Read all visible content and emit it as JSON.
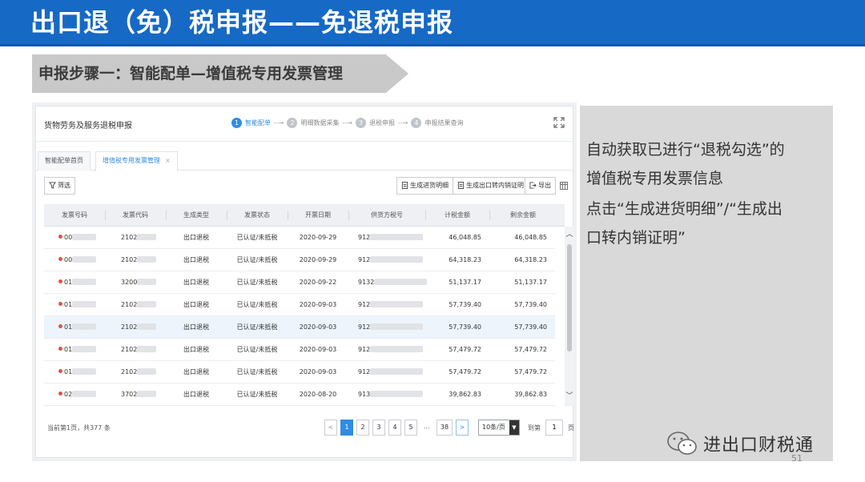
{
  "slide": {
    "title": "出口退（免）税申报——免退税申报",
    "step_banner": "申报步骤一：智能配单—增值税专用发票管理",
    "page_number": "51"
  },
  "app": {
    "window_title": "货物劳务及服务退税申报",
    "steps": [
      {
        "num": "1",
        "label": "智能配单",
        "active": true
      },
      {
        "num": "2",
        "label": "明细数据采集",
        "active": false
      },
      {
        "num": "3",
        "label": "退税申报",
        "active": false
      },
      {
        "num": "4",
        "label": "申报结果查询",
        "active": false
      }
    ],
    "tabs": [
      {
        "label": "智能配单首页",
        "active": false
      },
      {
        "label": "增值税专用发票管理",
        "active": true,
        "close": "×"
      }
    ],
    "toolbar": {
      "filter": "筛选",
      "gen_purchase": "生成进货明细",
      "gen_cert": "生成出口转内销证明",
      "export": "导出"
    },
    "table": {
      "columns": [
        "发票号码",
        "发票代码",
        "生成类型",
        "发票状态",
        "开票日期",
        "供货方税号",
        "计税金额",
        "剩余金额"
      ],
      "rows": [
        {
          "inv_no": "00",
          "inv_code": "2102",
          "type": "出口退税",
          "status": "已认证/未抵税",
          "date": "2020-09-29",
          "tax_id": "912",
          "amount": "46,048.85",
          "remain": "46,048.85",
          "highlight": false
        },
        {
          "inv_no": "00",
          "inv_code": "2102",
          "type": "出口退税",
          "status": "已认证/未抵税",
          "date": "2020-09-29",
          "tax_id": "912",
          "amount": "64,318.23",
          "remain": "64,318.23",
          "highlight": false
        },
        {
          "inv_no": "01",
          "inv_code": "3200",
          "type": "出口退税",
          "status": "已认证/未抵税",
          "date": "2020-09-22",
          "tax_id": "9132",
          "amount": "51,137.17",
          "remain": "51,137.17",
          "highlight": false
        },
        {
          "inv_no": "01",
          "inv_code": "2102",
          "type": "出口退税",
          "status": "已认证/未抵税",
          "date": "2020-09-03",
          "tax_id": "912",
          "amount": "57,739.40",
          "remain": "57,739.40",
          "highlight": false
        },
        {
          "inv_no": "01",
          "inv_code": "2102",
          "type": "出口退税",
          "status": "已认证/未抵税",
          "date": "2020-09-03",
          "tax_id": "912",
          "amount": "57,739.40",
          "remain": "57,739.40",
          "highlight": true
        },
        {
          "inv_no": "01",
          "inv_code": "2102",
          "type": "出口退税",
          "status": "已认证/未抵税",
          "date": "2020-09-03",
          "tax_id": "912",
          "amount": "57,479.72",
          "remain": "57,479.72",
          "highlight": false
        },
        {
          "inv_no": "01",
          "inv_code": "2102",
          "type": "出口退税",
          "status": "已认证/未抵税",
          "date": "2020-09-03",
          "tax_id": "912",
          "amount": "57,479.72",
          "remain": "57,479.72",
          "highlight": false
        },
        {
          "inv_no": "02",
          "inv_code": "3702",
          "type": "出口退税",
          "status": "已认证/未抵税",
          "date": "2020-08-20",
          "tax_id": "913",
          "amount": "39,862.83",
          "remain": "39,862.83",
          "highlight": false
        }
      ]
    },
    "pagination": {
      "info": "当前第1页，共377 条",
      "prev": "<",
      "pages": [
        "1",
        "2",
        "3",
        "4",
        "5"
      ],
      "dots": "...",
      "last": "38",
      "next": ">",
      "page_size": "10条/页",
      "goto_label": "到第",
      "goto_value": "1",
      "unit": "页"
    }
  },
  "explanation": {
    "lines": [
      "自动获取已进行“退税勾选”的",
      "增值税专用发票信息",
      "点击“生成进货明细”/“生成出",
      "口转内销证明”"
    ]
  },
  "watermark": {
    "text": "进出口财税通"
  },
  "colors": {
    "title_bar": "#1669c5",
    "accent": "#2f8de4",
    "banner": "#c9c9c9",
    "explain_bg": "#d9d9d9"
  }
}
